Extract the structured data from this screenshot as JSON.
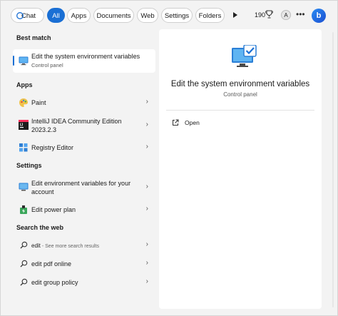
{
  "topbar": {
    "chat_label": "Chat",
    "tabs": [
      {
        "label": "All",
        "active": true
      },
      {
        "label": "Apps",
        "active": false
      },
      {
        "label": "Documents",
        "active": false
      },
      {
        "label": "Web",
        "active": false
      },
      {
        "label": "Settings",
        "active": false
      },
      {
        "label": "Folders",
        "active": false
      }
    ],
    "more_icon": "play-icon",
    "points": "190",
    "avatar_initial": "A",
    "menu": "•••",
    "bing_label": "b",
    "accent_color": "#1a6fd4"
  },
  "best_match": {
    "heading": "Best match",
    "title": "Edit the system environment variables",
    "subtitle": "Control panel",
    "icon": "system-properties-icon"
  },
  "apps": {
    "heading": "Apps",
    "items": [
      {
        "label": "Paint",
        "icon": "paint-icon"
      },
      {
        "label": "IntelliJ IDEA Community Edition",
        "label2": "2023.2.3",
        "icon": "intellij-icon"
      },
      {
        "label": "Registry Editor",
        "icon": "registry-icon"
      }
    ]
  },
  "settings": {
    "heading": "Settings",
    "items": [
      {
        "label": "Edit environment variables for your",
        "label2": "account",
        "icon": "monitor-settings-icon"
      },
      {
        "label": "Edit power plan",
        "icon": "power-plan-icon"
      }
    ]
  },
  "web": {
    "heading": "Search the web",
    "items": [
      {
        "label": "edit",
        "hint": " - See more search results",
        "icon": "search-icon"
      },
      {
        "label": "edit pdf online",
        "icon": "search-icon"
      },
      {
        "label": "edit group policy",
        "icon": "search-icon"
      }
    ]
  },
  "detail": {
    "title": "Edit the system environment variables",
    "subtitle": "Control panel",
    "open_label": "Open",
    "icon": "system-properties-icon"
  }
}
